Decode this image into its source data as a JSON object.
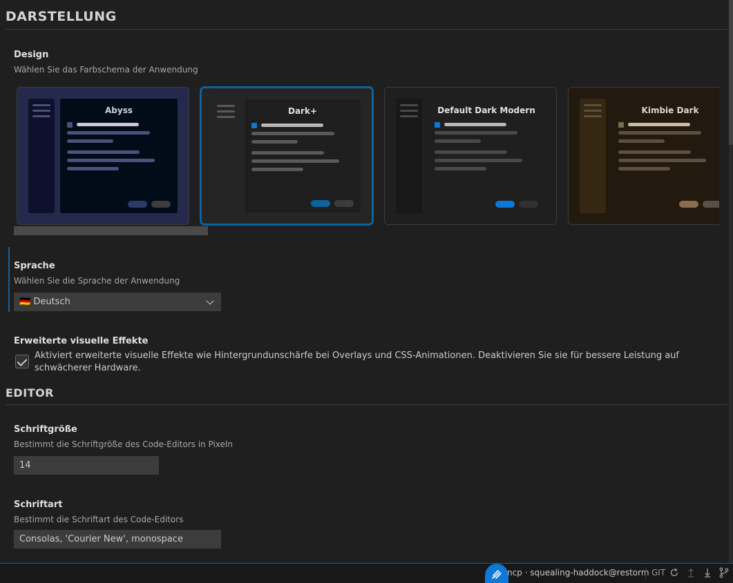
{
  "sections": {
    "appearance": "DARSTELLUNG",
    "editor": "EDITOR"
  },
  "design": {
    "title": "Design",
    "description": "Wählen Sie das Farbschema der Anwendung",
    "themes": [
      {
        "name": "Abyss",
        "selected": false,
        "border": "#3c3c3c",
        "outer": "#252a4d",
        "side": "#0f0f2e",
        "main": "#000c18",
        "text": "#d0d0e0",
        "bar": "#4a5277",
        "dot": "#4a5277",
        "btn1": "#2d3a66",
        "btn2": "#3c3c3c"
      },
      {
        "name": "Dark+",
        "selected": true,
        "border": "#0e639c",
        "outer": "#252526",
        "side": "#252526",
        "main": "#1e1e1e",
        "text": "#e0e0e0",
        "bar": "#5a5a5a",
        "dot": "#0e78d6",
        "btn1": "#0e639c",
        "btn2": "#3c3c3c"
      },
      {
        "name": "Default Dark Modern",
        "selected": false,
        "border": "#3c3c3c",
        "outer": "#1f1f1f",
        "side": "#181818",
        "main": "#1f1f1f",
        "text": "#e0e0e0",
        "bar": "#4a4a4a",
        "dot": "#0e78d6",
        "btn1": "#0e78d6",
        "btn2": "#313131"
      },
      {
        "name": "Kimbie Dark",
        "selected": false,
        "border": "#3c3c3c",
        "outer": "#221a0f",
        "side": "#362712",
        "main": "#221a0f",
        "text": "#e0d6c8",
        "bar": "#5e5040",
        "dot": "#7b6a52",
        "btn1": "#8a6e4d",
        "btn2": "#5a5048"
      }
    ]
  },
  "language": {
    "title": "Sprache",
    "description": "Wählen Sie die Sprache der Anwendung",
    "selected": "🇩🇪 Deutsch"
  },
  "effects": {
    "title": "Erweiterte visuelle Effekte",
    "checked": true,
    "label": "Aktiviert erweiterte visuelle Effekte wie Hintergrundunschärfe bei Overlays und CSS-Animationen. Deaktivieren Sie sie für bessere Leistung auf schwächerer Hardware."
  },
  "font_size": {
    "title": "Schriftgröße",
    "description": "Bestimmt die Schriftgröße des Code-Editors in Pixeln",
    "value": "14"
  },
  "font_family": {
    "title": "Schriftart",
    "description": "Bestimmt die Schriftart des Code-Editors",
    "value": "Consolas, 'Courier New', monospace"
  },
  "statusbar": {
    "remote_icon": "plug-icon",
    "connection": "ncp · squealing-haddock@restorm",
    "git_label": "GIT",
    "icons": [
      "refresh-icon",
      "push-icon",
      "pull-icon",
      "branch-icon"
    ]
  },
  "colors": {
    "accent": "#0e639c",
    "background": "#1f1f1f"
  }
}
